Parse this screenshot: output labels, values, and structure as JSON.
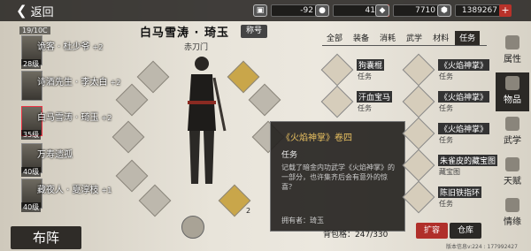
{
  "topbar": {
    "back_label": "返回",
    "resources": [
      {
        "icon": "cart-icon",
        "value": "-92"
      },
      {
        "icon": "coin-icon",
        "value": "41"
      },
      {
        "icon": "silver-icon",
        "value": "7710"
      },
      {
        "icon": "gold-ingot-icon",
        "value": "1389267"
      }
    ]
  },
  "team": {
    "header": "19/10C",
    "members": [
      {
        "level": "28级",
        "name": "诡客 · 杜少爷",
        "plus": "+2"
      },
      {
        "level": "",
        "name": "诗酒先生 · 李太白",
        "plus": "+2"
      },
      {
        "level": "35级",
        "name": "白马雪涛 · 琦玉",
        "plus": "+2"
      },
      {
        "level": "40级",
        "name": "万寿遗孤",
        "plus": ""
      },
      {
        "level": "40级",
        "name": "藏夜人 · 夏淳枝",
        "plus": "+1"
      }
    ],
    "formation_label": "布阵"
  },
  "hero": {
    "name": "白马雪涛 · 琦玉",
    "tag": "称号",
    "faction": "赤刀门",
    "slot_count_label": "2"
  },
  "tooltip": {
    "title": "《火焰神掌》卷四",
    "kind": "任务",
    "desc": "记载了暗金内功武学《火焰神掌》的一部分，也许集齐后会有意外的惊喜？",
    "owner": "拥有者：琦玉"
  },
  "inventory": {
    "tabs": [
      "全部",
      "装备",
      "消耗",
      "武学",
      "材料",
      "任务"
    ],
    "active_tab": "任务",
    "items": [
      {
        "name": "狗囊棍",
        "type": "任务"
      },
      {
        "name": "《火焰神掌》",
        "type": "任务"
      },
      {
        "name": "汗血宝马",
        "type": "任务"
      },
      {
        "name": "《火焰神掌》",
        "type": "任务"
      },
      {
        "name": "",
        "type": ""
      },
      {
        "name": "《火焰神掌》",
        "type": "任务"
      },
      {
        "name": "",
        "type": ""
      },
      {
        "name": "朱雀皮的藏宝图",
        "type": "藏宝图"
      },
      {
        "name": "",
        "type": ""
      },
      {
        "name": "陈旧铁指环",
        "type": "任务"
      }
    ],
    "bag_capacity": "背包格：247/330",
    "expand_label": "扩容",
    "store_label": "仓库",
    "version": "版本信息v:224 : 177992427"
  },
  "sidenav": [
    {
      "label": "属性",
      "icon": "attribute-icon"
    },
    {
      "label": "物品",
      "icon": "item-icon"
    },
    {
      "label": "武学",
      "icon": "martial-icon"
    },
    {
      "label": "天赋",
      "icon": "talent-icon"
    },
    {
      "label": "情缘",
      "icon": "bond-icon"
    }
  ],
  "colors": {
    "accent_red": "#b02f2a",
    "dark": "#2b2926",
    "gold": "#c9a64a"
  }
}
